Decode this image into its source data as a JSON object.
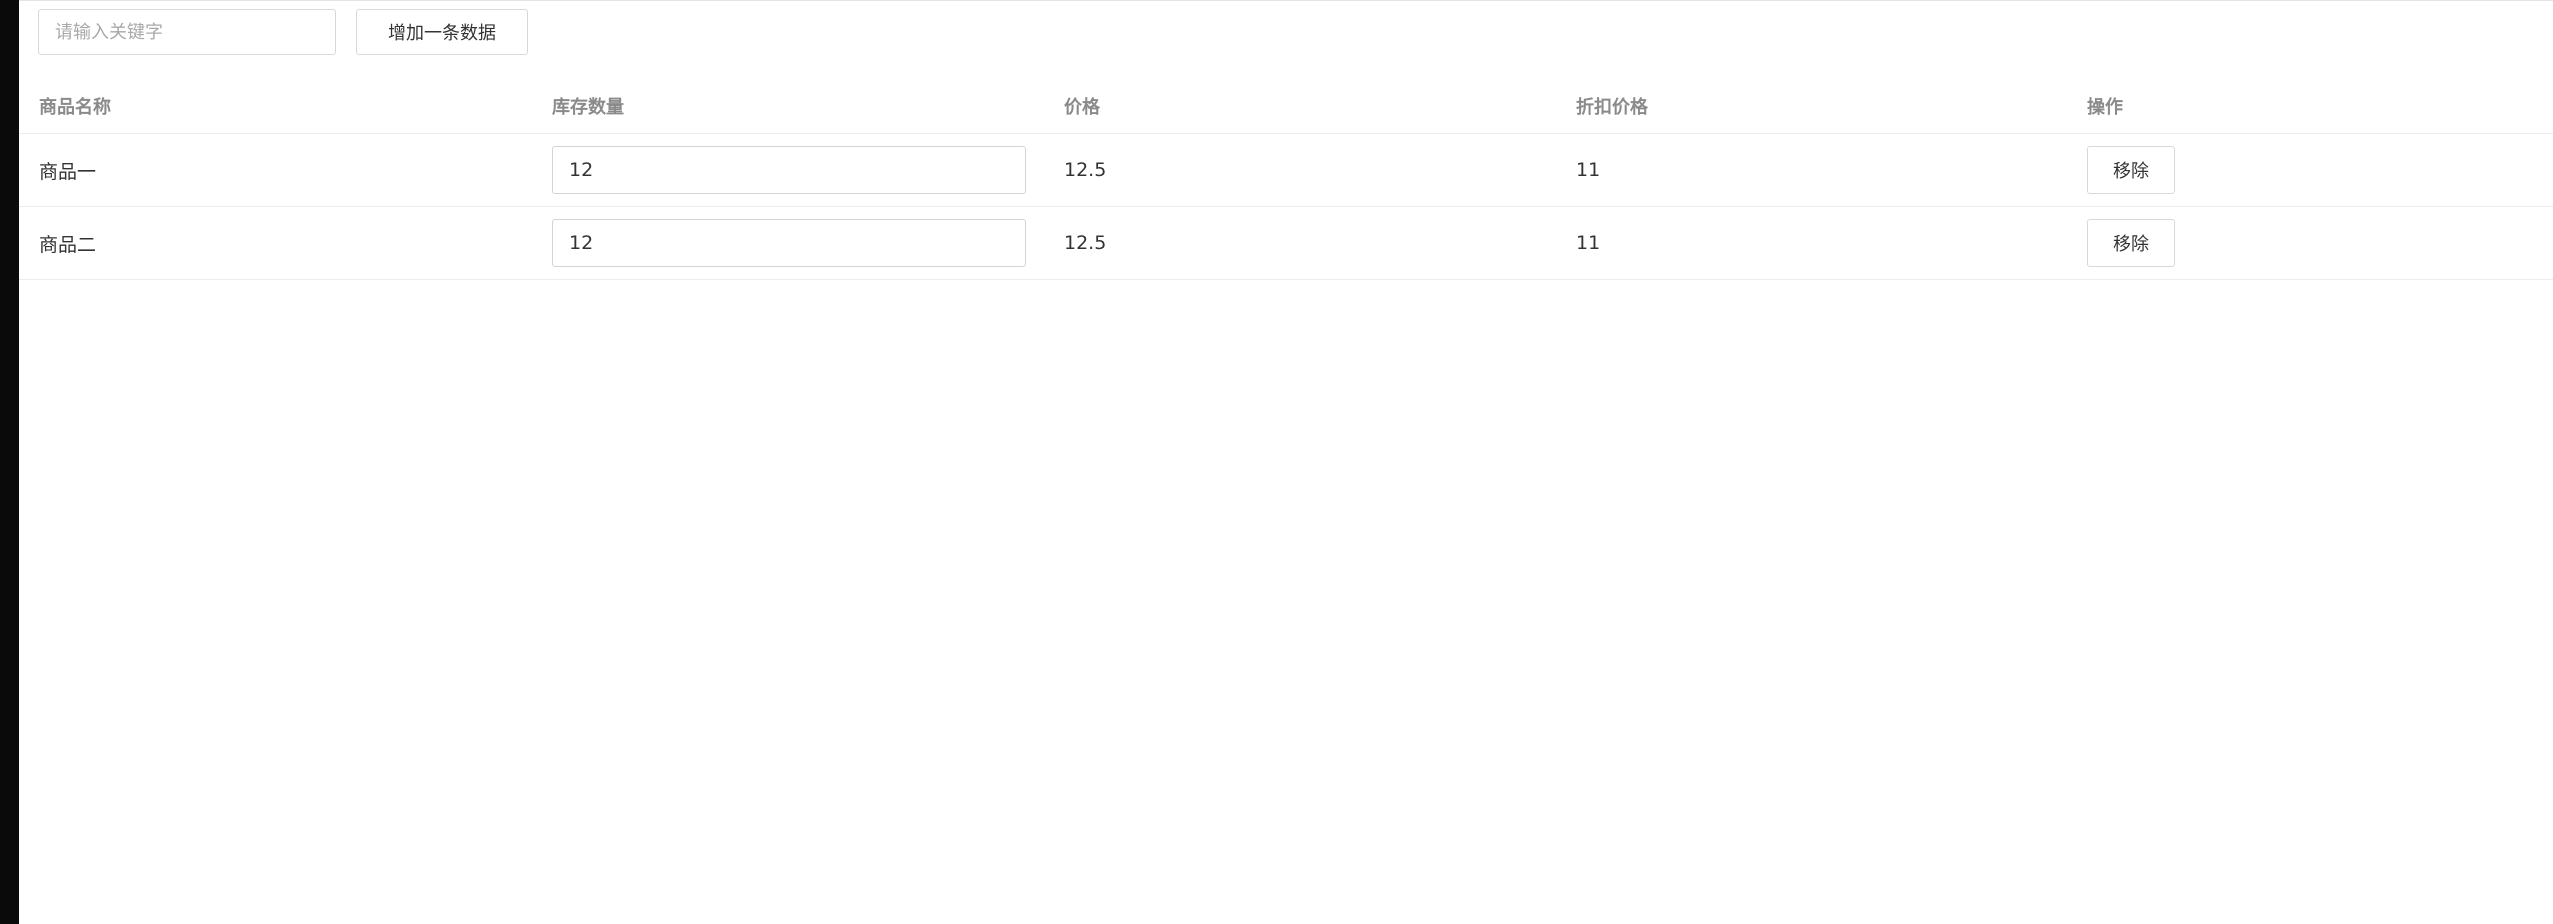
{
  "toolbar": {
    "search_placeholder": "请输入关键字",
    "search_value": "",
    "add_label": "增加一条数据"
  },
  "table": {
    "headers": [
      "商品名称",
      "库存数量",
      "价格",
      "折扣价格",
      "操作"
    ],
    "rows": [
      {
        "name": "商品一",
        "quantity": "12",
        "price": "12.5",
        "discount_price": "11",
        "action_label": "移除"
      },
      {
        "name": "商品二",
        "quantity": "12",
        "price": "12.5",
        "discount_price": "11",
        "action_label": "移除"
      }
    ]
  },
  "colors": {
    "left_bar": "#0a0a0a",
    "border": "#d9d9d9",
    "header_text": "#8a8a8a",
    "text": "#333333"
  }
}
